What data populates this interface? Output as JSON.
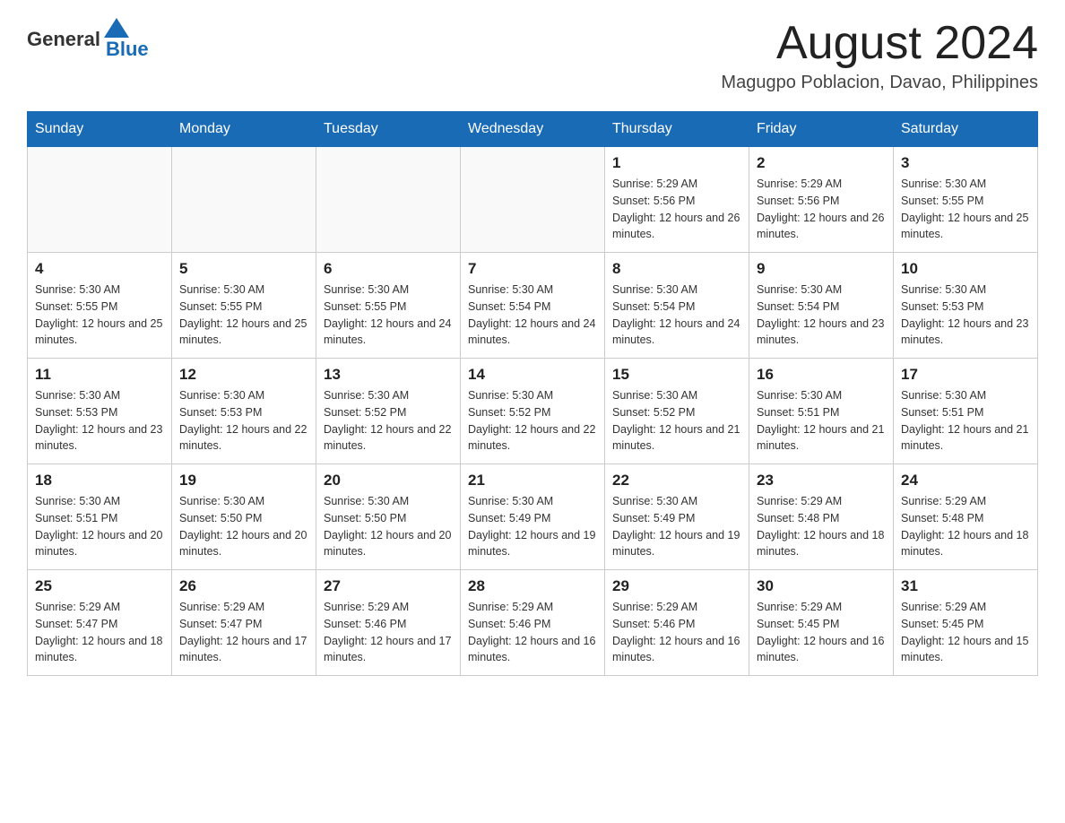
{
  "header": {
    "logo_general": "General",
    "logo_blue": "Blue",
    "month_title": "August 2024",
    "location": "Magugpo Poblacion, Davao, Philippines"
  },
  "days_of_week": [
    "Sunday",
    "Monday",
    "Tuesday",
    "Wednesday",
    "Thursday",
    "Friday",
    "Saturday"
  ],
  "weeks": [
    [
      {
        "day": "",
        "info": ""
      },
      {
        "day": "",
        "info": ""
      },
      {
        "day": "",
        "info": ""
      },
      {
        "day": "",
        "info": ""
      },
      {
        "day": "1",
        "info": "Sunrise: 5:29 AM\nSunset: 5:56 PM\nDaylight: 12 hours and 26 minutes."
      },
      {
        "day": "2",
        "info": "Sunrise: 5:29 AM\nSunset: 5:56 PM\nDaylight: 12 hours and 26 minutes."
      },
      {
        "day": "3",
        "info": "Sunrise: 5:30 AM\nSunset: 5:55 PM\nDaylight: 12 hours and 25 minutes."
      }
    ],
    [
      {
        "day": "4",
        "info": "Sunrise: 5:30 AM\nSunset: 5:55 PM\nDaylight: 12 hours and 25 minutes."
      },
      {
        "day": "5",
        "info": "Sunrise: 5:30 AM\nSunset: 5:55 PM\nDaylight: 12 hours and 25 minutes."
      },
      {
        "day": "6",
        "info": "Sunrise: 5:30 AM\nSunset: 5:55 PM\nDaylight: 12 hours and 24 minutes."
      },
      {
        "day": "7",
        "info": "Sunrise: 5:30 AM\nSunset: 5:54 PM\nDaylight: 12 hours and 24 minutes."
      },
      {
        "day": "8",
        "info": "Sunrise: 5:30 AM\nSunset: 5:54 PM\nDaylight: 12 hours and 24 minutes."
      },
      {
        "day": "9",
        "info": "Sunrise: 5:30 AM\nSunset: 5:54 PM\nDaylight: 12 hours and 23 minutes."
      },
      {
        "day": "10",
        "info": "Sunrise: 5:30 AM\nSunset: 5:53 PM\nDaylight: 12 hours and 23 minutes."
      }
    ],
    [
      {
        "day": "11",
        "info": "Sunrise: 5:30 AM\nSunset: 5:53 PM\nDaylight: 12 hours and 23 minutes."
      },
      {
        "day": "12",
        "info": "Sunrise: 5:30 AM\nSunset: 5:53 PM\nDaylight: 12 hours and 22 minutes."
      },
      {
        "day": "13",
        "info": "Sunrise: 5:30 AM\nSunset: 5:52 PM\nDaylight: 12 hours and 22 minutes."
      },
      {
        "day": "14",
        "info": "Sunrise: 5:30 AM\nSunset: 5:52 PM\nDaylight: 12 hours and 22 minutes."
      },
      {
        "day": "15",
        "info": "Sunrise: 5:30 AM\nSunset: 5:52 PM\nDaylight: 12 hours and 21 minutes."
      },
      {
        "day": "16",
        "info": "Sunrise: 5:30 AM\nSunset: 5:51 PM\nDaylight: 12 hours and 21 minutes."
      },
      {
        "day": "17",
        "info": "Sunrise: 5:30 AM\nSunset: 5:51 PM\nDaylight: 12 hours and 21 minutes."
      }
    ],
    [
      {
        "day": "18",
        "info": "Sunrise: 5:30 AM\nSunset: 5:51 PM\nDaylight: 12 hours and 20 minutes."
      },
      {
        "day": "19",
        "info": "Sunrise: 5:30 AM\nSunset: 5:50 PM\nDaylight: 12 hours and 20 minutes."
      },
      {
        "day": "20",
        "info": "Sunrise: 5:30 AM\nSunset: 5:50 PM\nDaylight: 12 hours and 20 minutes."
      },
      {
        "day": "21",
        "info": "Sunrise: 5:30 AM\nSunset: 5:49 PM\nDaylight: 12 hours and 19 minutes."
      },
      {
        "day": "22",
        "info": "Sunrise: 5:30 AM\nSunset: 5:49 PM\nDaylight: 12 hours and 19 minutes."
      },
      {
        "day": "23",
        "info": "Sunrise: 5:29 AM\nSunset: 5:48 PM\nDaylight: 12 hours and 18 minutes."
      },
      {
        "day": "24",
        "info": "Sunrise: 5:29 AM\nSunset: 5:48 PM\nDaylight: 12 hours and 18 minutes."
      }
    ],
    [
      {
        "day": "25",
        "info": "Sunrise: 5:29 AM\nSunset: 5:47 PM\nDaylight: 12 hours and 18 minutes."
      },
      {
        "day": "26",
        "info": "Sunrise: 5:29 AM\nSunset: 5:47 PM\nDaylight: 12 hours and 17 minutes."
      },
      {
        "day": "27",
        "info": "Sunrise: 5:29 AM\nSunset: 5:46 PM\nDaylight: 12 hours and 17 minutes."
      },
      {
        "day": "28",
        "info": "Sunrise: 5:29 AM\nSunset: 5:46 PM\nDaylight: 12 hours and 16 minutes."
      },
      {
        "day": "29",
        "info": "Sunrise: 5:29 AM\nSunset: 5:46 PM\nDaylight: 12 hours and 16 minutes."
      },
      {
        "day": "30",
        "info": "Sunrise: 5:29 AM\nSunset: 5:45 PM\nDaylight: 12 hours and 16 minutes."
      },
      {
        "day": "31",
        "info": "Sunrise: 5:29 AM\nSunset: 5:45 PM\nDaylight: 12 hours and 15 minutes."
      }
    ]
  ]
}
